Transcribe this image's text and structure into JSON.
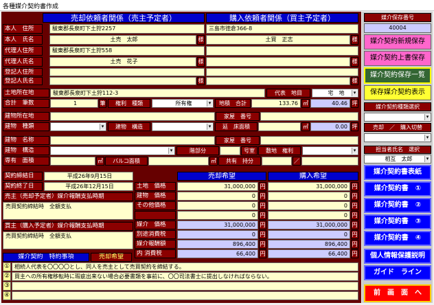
{
  "window": {
    "title": "各種媒介契約書作成"
  },
  "headers": {
    "seller": "売却依頼者関係（売主予定者）",
    "buyer": "購入依頼者関係（買主予定者）"
  },
  "seller": {
    "address_label": "本人　住所",
    "address": "駿東郡長泉町下土狩2257",
    "name_label": "本人　氏名",
    "name": "土売　太郎",
    "sama": "様",
    "agent_addr_label": "代理人住所",
    "agent_addr": "駿東郡長泉町下土狩558",
    "agent_name_label": "代理人氏名",
    "agent_name": "土売　花子",
    "reg_addr_label": "登記人住所",
    "reg_name_label": "登記人氏名"
  },
  "buyer": {
    "address": "三島市徳倉366-8",
    "name": "土買　正志",
    "sama": "様"
  },
  "land": {
    "loc_label": "土地所在地",
    "loc": "駿東郡長泉町下土狩112-3",
    "daihyo_label": "代表　地目",
    "chimoku": "宅　地",
    "total_label": "合計　筆数",
    "hissu": "1",
    "hitsu": "筆",
    "kenri_label": "権利　種類",
    "kenri": "所有権",
    "area_label": "地積　合計",
    "area": "133.76",
    "m2": "㎡",
    "tsubo_val": "40.46",
    "tsubo": "坪"
  },
  "building": {
    "loc_label": "建物所在地",
    "kaoku_label": "家屋　番号",
    "type_label": "建物　種類",
    "kozo_label": "建物　構造",
    "nobe_label": "延　床面積",
    "nobe_val": "0.00",
    "tsubo": "坪",
    "name_label": "建物　名称",
    "kaoku2_label": "家屋　番号",
    "kozo2_label": "建物　構造",
    "kaibun_label": "階部分",
    "gochitsu_label": "号室",
    "shikichi_label": "敷地　権利",
    "senyu_label": "専有　面積",
    "m2": "㎡",
    "balcony_label": "バルコ面積",
    "kyoyu_label": "共有　持分",
    "slash": "／"
  },
  "contract": {
    "start_label": "契約締結日",
    "start": "平成26年9月15日",
    "end_label": "契約終了日",
    "end": "平成26年12月15日",
    "seller_timing_label": "売主（売却予定者）媒介報酬支払時期",
    "seller_timing": "売買契約締結時　全額支払",
    "buyer_timing_label": "買主（購入予定者）媒介報酬支払時期",
    "buyer_timing": "売買契約締結時　全額支払",
    "tokuyaku_label": "媒介契約　特約事項",
    "baikyaku_kibo": "売却希望"
  },
  "price": {
    "sell_header": "売却希望",
    "buy_header": "購入希望",
    "yen": "円",
    "rows": [
      {
        "label": "土地　価格",
        "sell": "31,000,000",
        "buy": "31,000,000"
      },
      {
        "label": "建物　価格",
        "sell": "0",
        "buy": "0"
      },
      {
        "label": "その他価格",
        "sell": "0",
        "buy": "0"
      },
      {
        "label": "",
        "sell": "0",
        "buy": "0"
      },
      {
        "label": "媒介　価格",
        "sell": "31,000,000",
        "buy": "31,000,000"
      },
      {
        "label": "別途消費税",
        "sell": "0",
        "buy": "0"
      },
      {
        "label": "媒介報酬額",
        "sell": "896,400",
        "buy": "896,400"
      },
      {
        "label": "内 消費税",
        "sell": "66,400",
        "buy": "66,400"
      }
    ]
  },
  "tokuyaku": [
    {
      "no": "①",
      "text": "相続人代表を〇〇〇〇とし、同人を売主として売買契約を締結する。"
    },
    {
      "no": "②",
      "text": "買主への所有権移転時に瑕疵出来ない場合必要書類を事前に、〇〇司法書士に提出しなければならない。"
    },
    {
      "no": "③",
      "text": ""
    },
    {
      "no": "④",
      "text": ""
    }
  ],
  "side": {
    "hozon_label": "媒介保存番号",
    "hozon_no": "40004",
    "new_save": "媒介契約新規保存",
    "overwrite": "媒介契約上書保存",
    "list": "媒介契約保存一覧",
    "show": "保存媒介契約表示",
    "type_select": "媒介契約種類選択",
    "sell_buy": "売却　／　購入切替",
    "tanto_label": "担当者氏名　選択",
    "tanto": "相互　太郎",
    "cover": "媒介契約書表紙",
    "doc1": "媒介契約書　①",
    "doc2": "媒介契約書　②",
    "doc3": "媒介契約書　③",
    "doc4": "媒介契約書　④",
    "privacy": "個人情報保護説明",
    "guide": "ガイド　ライン",
    "back": "前　画　面　へ"
  }
}
